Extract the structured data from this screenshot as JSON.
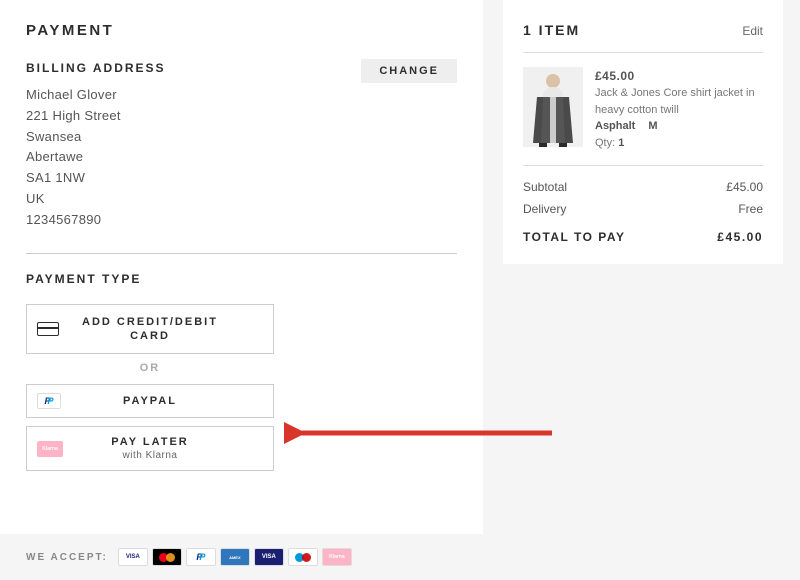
{
  "payment": {
    "title": "PAYMENT",
    "billing_title": "BILLING ADDRESS",
    "change_label": "CHANGE",
    "address": {
      "name": "Michael Glover",
      "line1": "221 High Street",
      "city": "Swansea",
      "locality": "Abertawe",
      "postcode": "SA1 1NW",
      "country": "UK",
      "phone": "1234567890"
    },
    "payment_type_title": "PAYMENT TYPE",
    "options": {
      "card": "ADD CREDIT/DEBIT CARD",
      "or": "OR",
      "paypal": "PAYPAL",
      "paylater": "PAY LATER",
      "paylater_sub": "with Klarna"
    },
    "accept_label": "WE ACCEPT:"
  },
  "summary": {
    "count_label": "1 ITEM",
    "edit_label": "Edit",
    "item": {
      "price": "£45.00",
      "name": "Jack & Jones Core shirt jacket in heavy cotton twill",
      "color": "Asphalt",
      "size": "M",
      "qty_label": "Qty:",
      "qty": "1"
    },
    "subtotal_label": "Subtotal",
    "subtotal": "£45.00",
    "delivery_label": "Delivery",
    "delivery": "Free",
    "total_label": "TOTAL TO PAY",
    "total": "£45.00"
  }
}
